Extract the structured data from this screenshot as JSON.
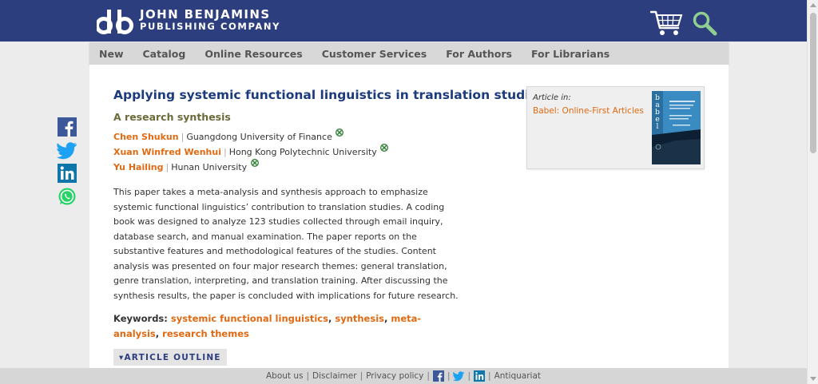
{
  "header": {
    "logo_line1": "JOHN BENJAMINS",
    "logo_line2": "PUBLISHING COMPANY",
    "icons": [
      "db-logo-icon",
      "cart-icon",
      "search-icon"
    ]
  },
  "nav": {
    "items": [
      "New",
      "Catalog",
      "Online Resources",
      "Customer Services",
      "For Authors",
      "For Librarians"
    ]
  },
  "article": {
    "title": "Applying systemic functional linguistics in translation studies",
    "subtitle": "A research synthesis",
    "authors": [
      {
        "name": "Chen Shukun",
        "affiliation": "Guangdong University of Finance"
      },
      {
        "name": "Xuan Winfred Wenhui",
        "affiliation": "Hong Kong Polytechnic University"
      },
      {
        "name": "Yu Hailing",
        "affiliation": "Hunan University"
      }
    ],
    "author_separator": "|",
    "abstract": "This paper takes a meta-analysis and synthesis approach to emphasize systemic functional linguistics’ contribution to translation studies. A coding book was designed to analyze 123 studies collected through email inquiry, database search, and manual examination. The paper reports on the substantive features and methodological features of the studies. Content analysis was presented on four major research themes: general translation, genre translation, interpreting, and translation training. After discussing the synthesis results, the paper is concluded with implications for future research.",
    "keywords_label": "Keywords:",
    "keywords": [
      "systemic functional linguistics",
      "synthesis",
      "meta-analysis",
      "research themes"
    ],
    "keyword_separator": ",",
    "outline_button": "▾ARTICLE OUTLINE"
  },
  "article_in": {
    "label": "Article in:",
    "journal": "Babel: Online-First Articles",
    "cover_text": "babel"
  },
  "social": [
    "facebook-icon",
    "twitter-icon",
    "linkedin-icon",
    "whatsapp-icon"
  ],
  "footer": {
    "about": "About us",
    "disclaimer": "Disclaimer",
    "privacy": "Privacy policy",
    "antiquariat": "Antiquariat",
    "separator": "|"
  },
  "colors": {
    "header_bg": "#2d3e7f",
    "accent_orange": "#e06a13",
    "title_blue": "#1c3b7c",
    "subtitle_olive": "#6b6b3a"
  }
}
